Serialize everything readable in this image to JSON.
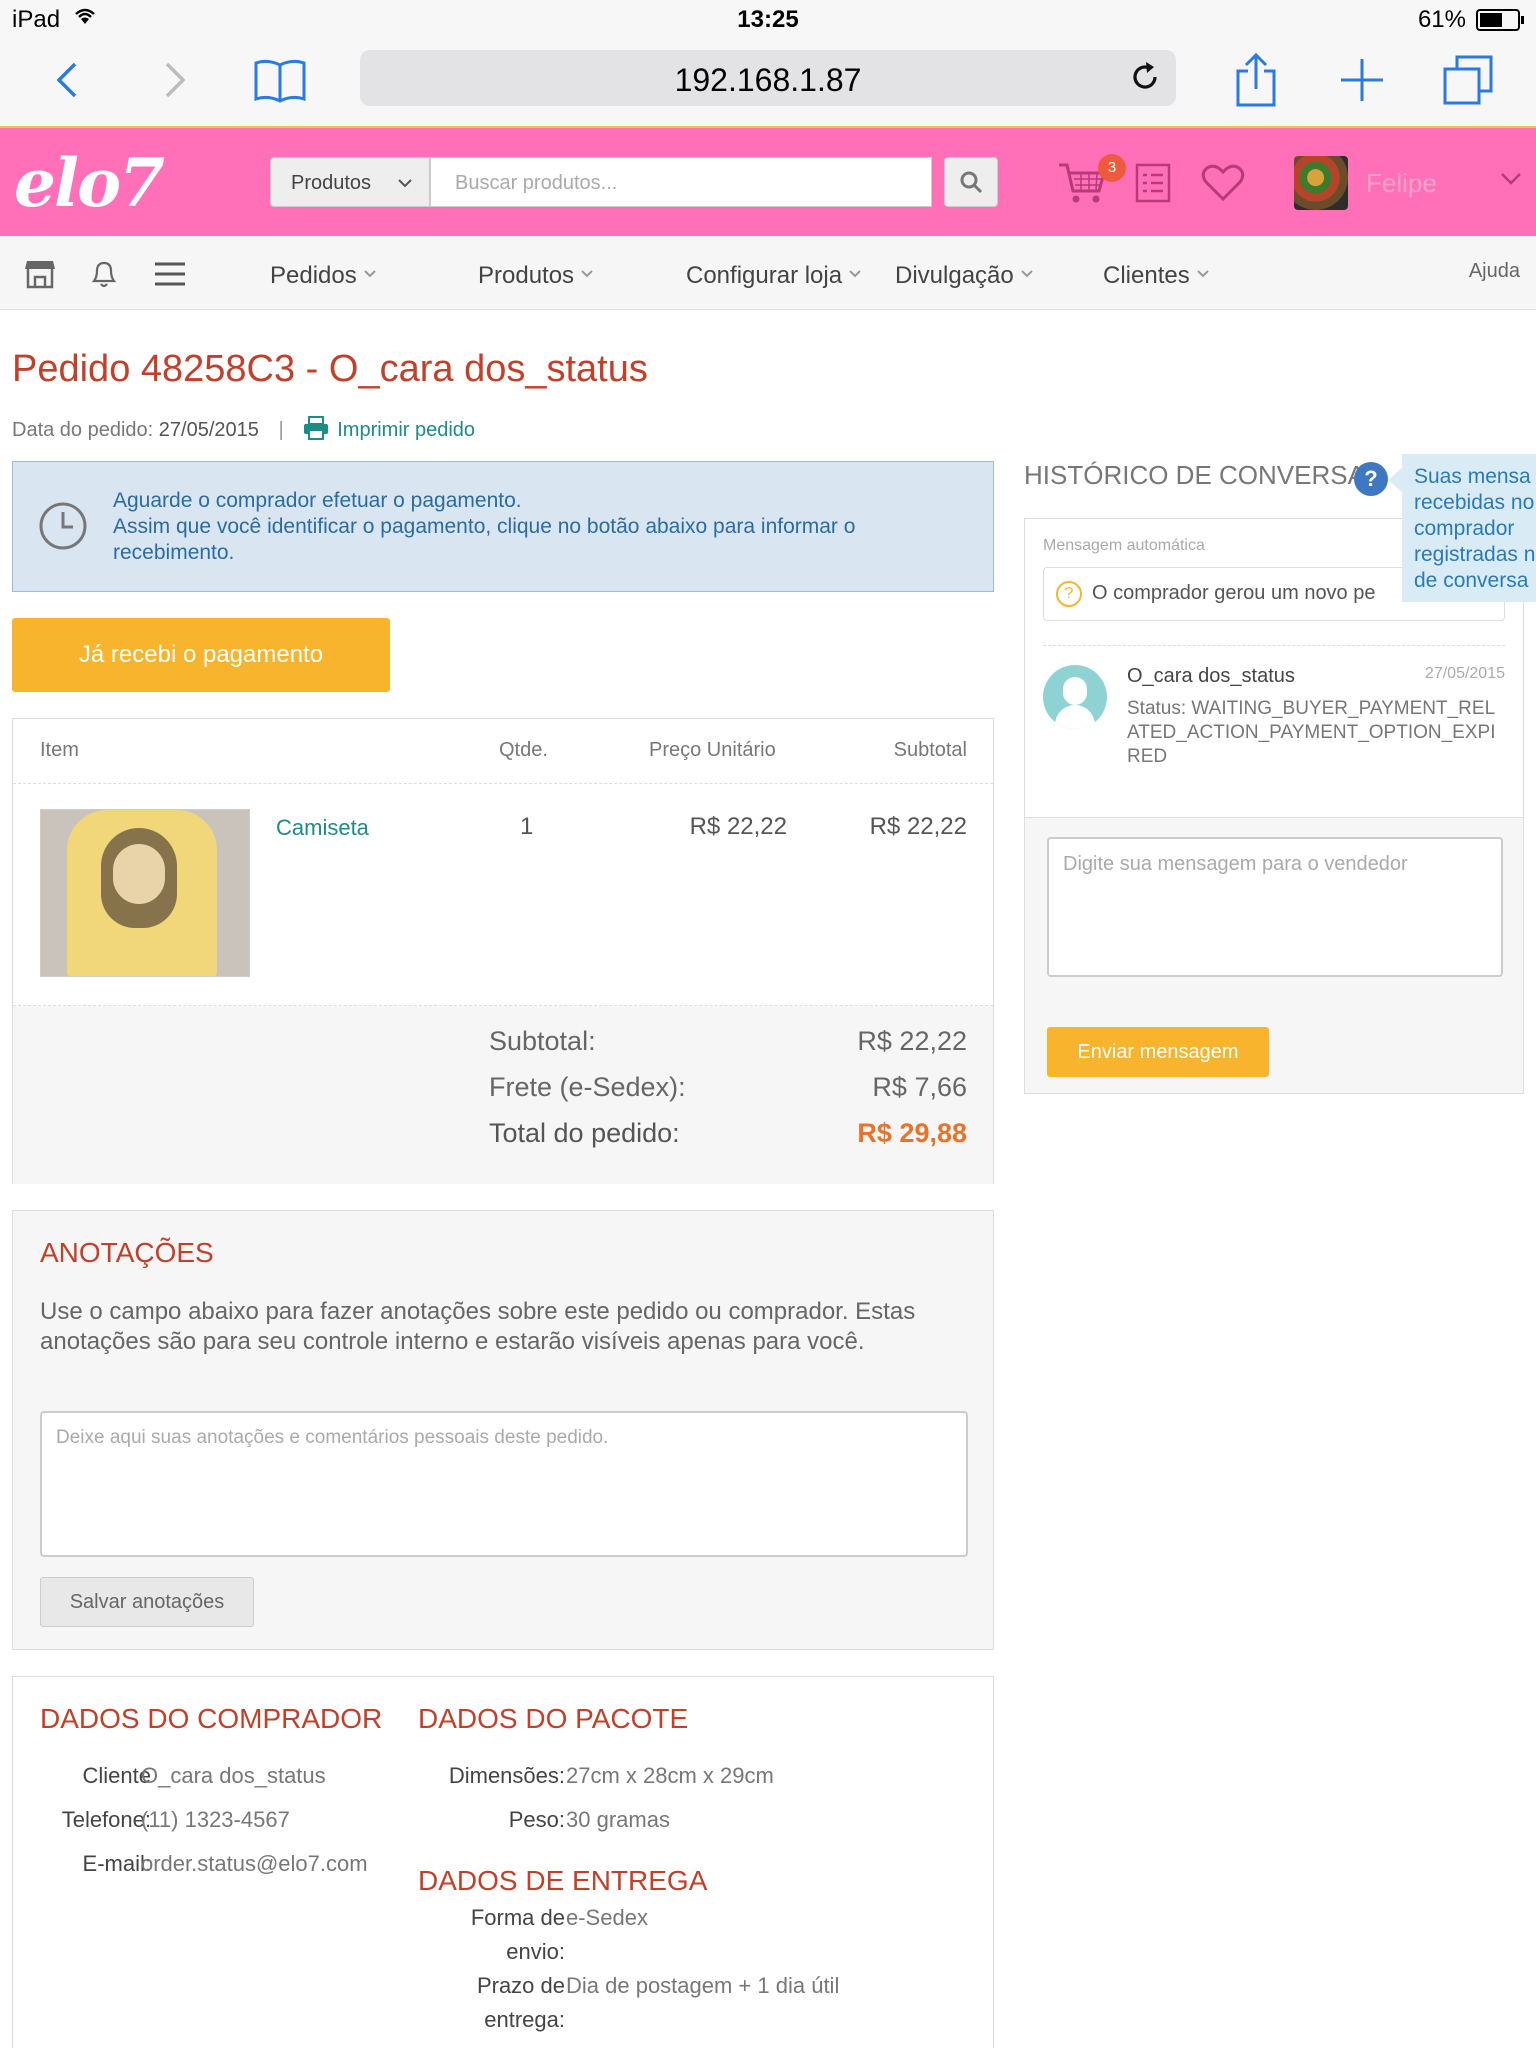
{
  "status_bar": {
    "carrier": "iPad",
    "time": "13:25",
    "battery": "61%",
    "battery_level": 0.61
  },
  "safari": {
    "url": "192.168.1.87"
  },
  "header": {
    "logo": "elo7",
    "search_category": "Produtos",
    "search_placeholder": "Buscar produtos...",
    "cart_count": "3",
    "user_name": "Felipe",
    "brand_color": "#ff70b8"
  },
  "nav": {
    "items": [
      "Pedidos",
      "Produtos",
      "Configurar loja",
      "Divulgação",
      "Clientes"
    ],
    "help": "Ajuda"
  },
  "order": {
    "title": "Pedido 48258C3 - O_cara dos_status",
    "date_label": "Data do pedido:",
    "date": "27/05/2015",
    "separator": "|",
    "print_label": "Imprimir pedido"
  },
  "alert": {
    "line1": "Aguarde o comprador efetuar o pagamento.",
    "line2": "Assim que você identificar o pagamento, clique no botão abaixo para informar o recebimento."
  },
  "pay_button": "Já recebi o pagamento",
  "items_table": {
    "headers": {
      "item": "Item",
      "qty": "Qtde.",
      "unit_price": "Preço Unitário",
      "subtotal": "Subtotal"
    },
    "rows": [
      {
        "name": "Camiseta",
        "qty": "1",
        "unit_price": "R$ 22,22",
        "subtotal": "R$ 22,22"
      }
    ],
    "totals": {
      "subtotal_label": "Subtotal:",
      "subtotal_value": "R$ 22,22",
      "shipping_label": "Frete (e-Sedex):",
      "shipping_value": "R$ 7,66",
      "total_label": "Total do pedido:",
      "total_value": "R$ 29,88"
    }
  },
  "notes": {
    "title": "ANOTAÇÕES",
    "description": "Use o campo abaixo para fazer anotações sobre este pedido ou comprador. Estas anotações são para seu controle interno e estarão visíveis apenas para você.",
    "placeholder": "Deixe aqui suas anotações e comentários pessoais deste pedido.",
    "save_button": "Salvar anotações"
  },
  "buyer": {
    "title": "DADOS DO COMPRADOR",
    "client_label": "Cliente",
    "client_value": "O_cara dos_status",
    "phone_label": "Telefone:",
    "phone_value": "(11) 1323-4567",
    "email_label": "E-mail:",
    "email_value": "order.status@elo7.com"
  },
  "package": {
    "title": "DADOS DO PACOTE",
    "dimensions_label": "Dimensões:",
    "dimensions_value": "27cm x 28cm x 29cm",
    "weight_label": "Peso:",
    "weight_value": "30 gramas"
  },
  "delivery": {
    "title": "DADOS DE ENTREGA",
    "method_label_1": "Forma de",
    "method_label_2": "envio:",
    "method_value": "e-Sedex",
    "deadline_label_1": "Prazo de",
    "deadline_label_2": "entrega:",
    "deadline_value": "Dia de postagem + 1 dia útil"
  },
  "chat": {
    "title": "HISTÓRICO DE CONVERSA",
    "help": "?",
    "tooltip": "Suas mensa\nrecebidas no\ncomprador\nregistradas n\nde conversa",
    "auto_label": "Mensagem automática",
    "auto_message": "O comprador gerou um novo pe",
    "sender": "O_cara dos_status",
    "date": "27/05/2015",
    "message": "Status: WAITING_BUYER_PAYMENT_RELATED_ACTION_PAYMENT_OPTION_EXPIRED",
    "input_placeholder": "Digite sua mensagem para o vendedor",
    "send_button": "Enviar mensagem"
  }
}
